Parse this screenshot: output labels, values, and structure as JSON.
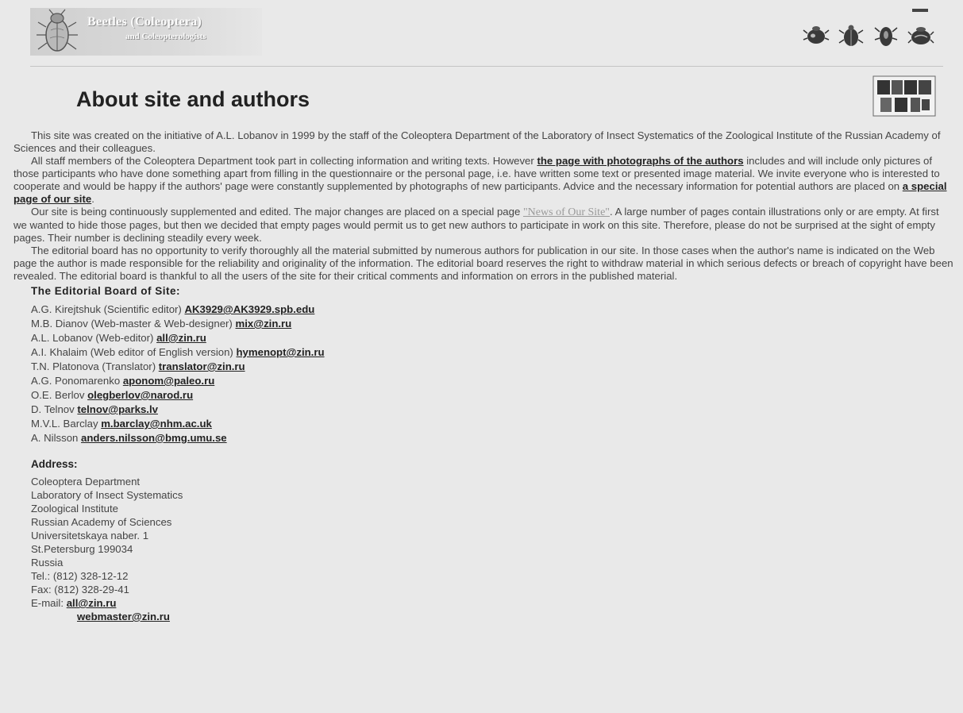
{
  "header": {
    "logo_title": "Beetles (Coleoptera)",
    "logo_subtitle": "and Coleopterologists",
    "nav_icons": [
      "beetle-nav-icon-1",
      "beetle-nav-icon-2",
      "beetle-nav-icon-3",
      "beetle-nav-icon-4"
    ]
  },
  "page": {
    "title": "About site and authors"
  },
  "intro": {
    "p1": "This site was created on the initiative of A.L. Lobanov in 1999 by the staff of the Coleoptera Department of the Laboratory of Insect Systematics of the Zoological Institute of the Russian Academy of Sciences and their colleagues.",
    "p2_a": "All staff members of the Coleoptera Department took part in collecting information and writing texts. However ",
    "p2_link1": "the page with photographs of the authors",
    "p2_b": " includes and will include only pictures of those participants who have done something apart from filling in the questionnaire or the personal page, i.e. have written some text or presented image material. We invite everyone who is interested to cooperate and would be happy if the authors' page were constantly supplemented by photographs of new participants. Advice and the necessary information for potential authors are placed on ",
    "p2_link2": "a special page of our site",
    "p2_c": ".",
    "p3_a": "Our site is being continuously supplemented and edited. The major changes are placed on a special page ",
    "p3_link": "\"News of Our Site\"",
    "p3_b": ". A large number of pages contain illustrations only or are empty. At first we wanted to hide those pages, but then we decided that empty pages would permit us to get new authors to participate in work on this site. Therefore, please do not be surprised at the sight of empty pages. Their number is declining steadily every week.",
    "p4": "The editorial board has no opportunity to verify thoroughly all the material submitted by numerous authors for publication in our site. In those cases when the author's name is indicated on the Web page the author is made responsible for the reliability and originality of the information. The editorial board reserves the right to withdraw material in which serious defects or breach of copyright have been revealed. The editorial board is thankful to all the users of the site for their critical comments and information on errors in the published material."
  },
  "board": {
    "heading": "The Editorial Board of Site:",
    "members": [
      {
        "name": "A.G. Kirejtshuk (Scientific editor) ",
        "email": "AK3929@AK3929.spb.edu"
      },
      {
        "name": "M.B. Dianov (Web-master & Web-designer) ",
        "email": "mix@zin.ru"
      },
      {
        "name": "A.L. Lobanov (Web-editor) ",
        "email": "all@zin.ru"
      },
      {
        "name": "A.I. Khalaim (Web editor of English version) ",
        "email": "hymenopt@zin.ru"
      },
      {
        "name": "T.N. Platonova (Translator) ",
        "email": "translator@zin.ru"
      },
      {
        "name": "A.G. Ponomarenko ",
        "email": "aponom@paleo.ru"
      },
      {
        "name": "O.E. Berlov ",
        "email": "olegberlov@narod.ru"
      },
      {
        "name": "D. Telnov ",
        "email": "telnov@parks.lv"
      },
      {
        "name": "M.V.L. Barclay ",
        "email": "m.barclay@nhm.ac.uk"
      },
      {
        "name": "A. Nilsson ",
        "email": "anders.nilsson@bmg.umu.se"
      }
    ]
  },
  "address": {
    "heading": "Address:",
    "lines": [
      "Coleoptera Department",
      "Laboratory of Insect Systematics",
      "Zoological Institute",
      "Russian Academy of Sciences",
      "Universitetskaya naber. 1",
      "St.Petersburg 199034",
      "Russia",
      "Tel.: (812) 328-12-12",
      "Fax: (812) 328-29-41"
    ],
    "email_label": "E-mail: ",
    "email1": "all@zin.ru",
    "email2": "webmaster@zin.ru"
  },
  "colors": {
    "background": "#e9e9e9",
    "text": "#444444",
    "link": "#222222",
    "muted_link": "#9a9a9a"
  }
}
